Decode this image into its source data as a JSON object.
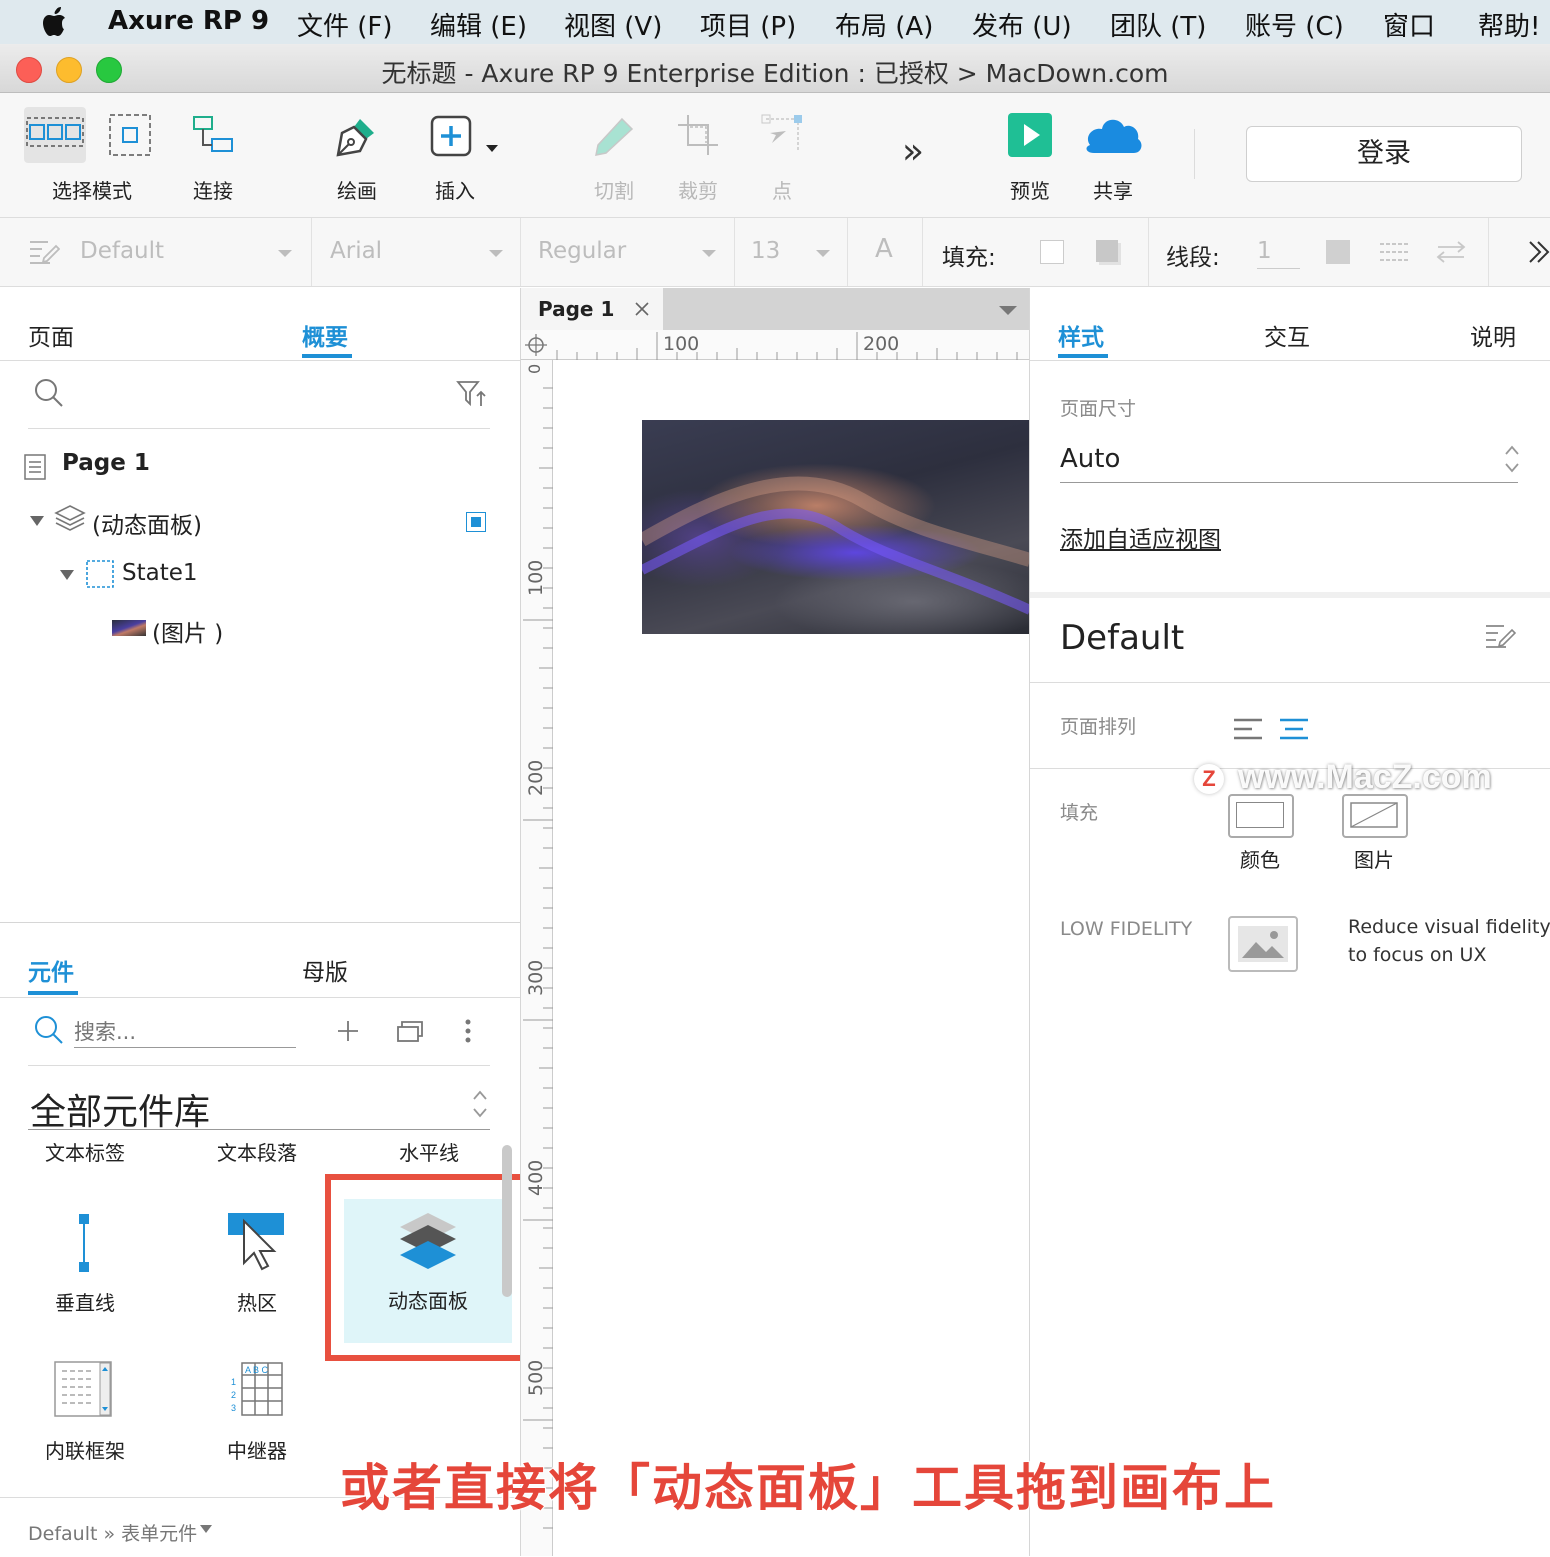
{
  "menubar": {
    "app_name": "Axure RP 9",
    "items": [
      "文件 (F)",
      "编辑 (E)",
      "视图 (V)",
      "项目 (P)",
      "布局 (A)",
      "发布 (U)",
      "团队 (T)",
      "账号 (C)",
      "窗口",
      "帮助!"
    ]
  },
  "window": {
    "title": "无标题 - Axure RP 9 Enterprise Edition : 已授权 > MacDown.com"
  },
  "toolbar": {
    "select_mode": "选择模式",
    "connect": "连接",
    "draw": "绘画",
    "insert": "插入",
    "cut": "切割",
    "crop": "裁剪",
    "point": "点",
    "more": "»",
    "preview": "预览",
    "share": "共享",
    "login": "登录"
  },
  "formatbar": {
    "style": "Default",
    "font": "Arial",
    "weight": "Regular",
    "size": "13",
    "font_color_glyph": "A",
    "fill_label": "填充:",
    "line_label": "线段:",
    "line_value": "1"
  },
  "left_panel": {
    "tabs": [
      "页面",
      "概要"
    ],
    "active_tab": "概要",
    "tree": {
      "page": "Page 1",
      "dynamic_panel": "(动态面板)",
      "state": "State1",
      "image": "(图片 )"
    }
  },
  "library_panel": {
    "tabs": [
      "元件",
      "母版"
    ],
    "active_tab": "元件",
    "search_placeholder": "搜索...",
    "library_select": "全部元件库",
    "row_labels": [
      "文本标签",
      "文本段落",
      "水平线"
    ],
    "widgets": [
      "垂直线",
      "热区",
      "动态面板",
      "内联框架",
      "中继器"
    ],
    "footer": "Default » 表单元件"
  },
  "canvas": {
    "tab": "Page 1",
    "ruler_h": [
      "100",
      "200"
    ],
    "ruler_v": [
      "0",
      "100",
      "200",
      "300",
      "400",
      "500"
    ]
  },
  "right_panel": {
    "tabs": [
      "样式",
      "交互",
      "说明"
    ],
    "active_tab": "样式",
    "page_size_label": "页面尺寸",
    "page_size_value": "Auto",
    "add_adaptive": "添加自适应视图",
    "style_name": "Default",
    "page_align_label": "页面排列",
    "fill_label": "填充",
    "fill_color": "颜色",
    "fill_image": "图片",
    "low_fidelity_label": "LOW FIDELITY",
    "low_fidelity_desc_1": "Reduce visual fidelity",
    "low_fidelity_desc_2": "to focus on UX"
  },
  "watermark": "www.MacZ.com",
  "caption": "或者直接将「动态面板」工具拖到画布上",
  "colors": {
    "accent": "#1e90d6",
    "highlight_box": "#e8503f",
    "caption": "#e5463a",
    "preview_green": "#1fbf95",
    "share_blue": "#1a8be0"
  }
}
